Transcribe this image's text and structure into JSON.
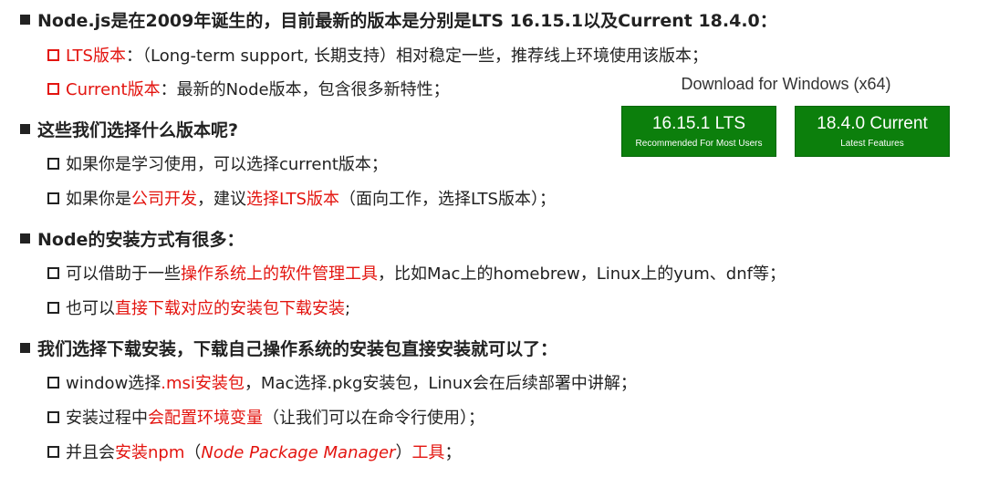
{
  "section1": {
    "heading": "Node.js是在2009年诞生的，目前最新的版本是分别是LTS 16.15.1以及Current 18.4.0：",
    "items": [
      {
        "highlight": "LTS版本",
        "rest": "：（Long-term support, 长期支持）相对稳定一些，推荐线上环境使用该版本；"
      },
      {
        "highlight": "Current版本",
        "rest": "：最新的Node版本，包含很多新特性；"
      }
    ]
  },
  "download": {
    "title": "Download for Windows (x64)",
    "lts": {
      "version": "16.15.1 LTS",
      "subtitle": "Recommended For Most Users"
    },
    "current": {
      "version": "18.4.0 Current",
      "subtitle": "Latest Features"
    }
  },
  "section2": {
    "heading": "这些我们选择什么版本呢?",
    "item1": "如果你是学习使用，可以选择current版本；",
    "item2": {
      "p1": "如果你是",
      "r1": "公司开发",
      "p2": "，建议",
      "r2": "选择LTS版本",
      "p3": "（面向工作，选择LTS版本）；"
    }
  },
  "section3": {
    "heading": "Node的安装方式有很多：",
    "item1": {
      "p1": "可以借助于一些",
      "r1": "操作系统上的软件管理工具",
      "p2": "，比如Mac上的homebrew，Linux上的yum、dnf等；"
    },
    "item2": {
      "p1": "也可以",
      "r1": "直接下载对应的安装包下载安装",
      "p2": ";"
    }
  },
  "section4": {
    "heading": "我们选择下载安装，下载自己操作系统的安装包直接安装就可以了：",
    "item1": {
      "p1": "window选择",
      "r1": ".msi安装包",
      "p2": "，Mac选择.pkg安装包，Linux会在后续部署中讲解；"
    },
    "item2": {
      "p1": "安装过程中",
      "r1": "会配置环境变量",
      "p2": "（让我们可以在命令行使用）；"
    },
    "item3": {
      "p1": "并且会",
      "r1": "安装npm",
      "p2": "（",
      "i1": "Node Package Manager",
      "p3": "）",
      "r2": "工具",
      "p4": "；"
    }
  }
}
